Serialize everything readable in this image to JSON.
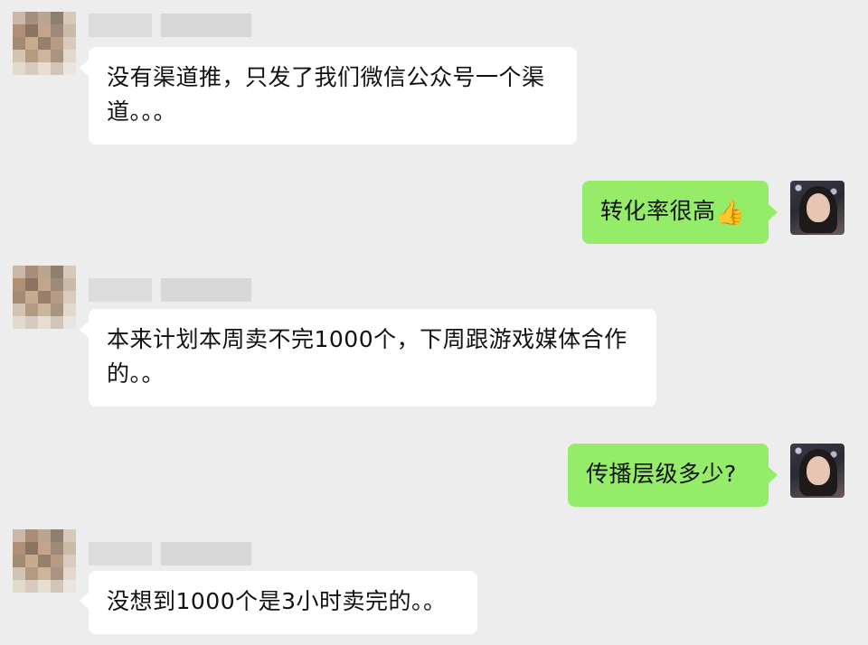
{
  "messages": [
    {
      "side": "in",
      "text": "没有渠道推，只发了我们微信公众号一个渠道。。。"
    },
    {
      "side": "out",
      "text": "转化率很高",
      "emoji": "👍"
    },
    {
      "side": "in",
      "text": "本来计划本周卖不完1000个，下周跟游戏媒体合作的。。"
    },
    {
      "side": "out",
      "text": "传播层级多少?"
    },
    {
      "side": "in",
      "text": "没想到1000个是3小时卖完的。。"
    }
  ],
  "colors": {
    "background": "#ededed",
    "incoming_bubble": "#ffffff",
    "outgoing_bubble": "#95ec69"
  }
}
